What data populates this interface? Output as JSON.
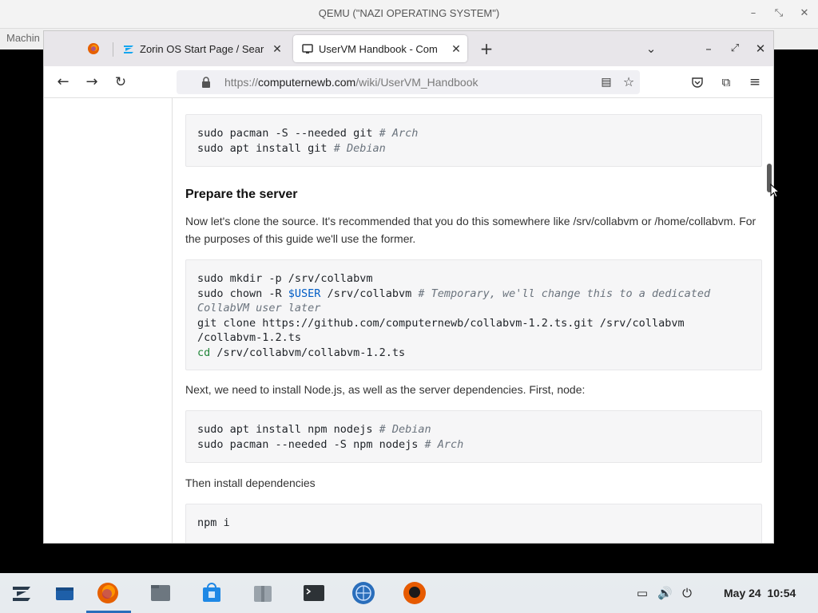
{
  "qemu": {
    "title": "QEMU (\"NAZI OPERATING SYSTEM\")",
    "menu_label": "Machin"
  },
  "browser": {
    "tabs": [
      {
        "label": "",
        "icon": "firefox-icon"
      },
      {
        "label": "Zorin OS Start Page / Sear",
        "icon": "zorin-icon"
      },
      {
        "label": "UserVM Handbook - Com",
        "icon": "uservm-icon"
      }
    ],
    "new_tab": "+",
    "url_scheme": "https://",
    "url_host": "computernewb.com",
    "url_path": "/wiki/UserVM_Handbook"
  },
  "page": {
    "code1": [
      {
        "cmd": "sudo pacman -S --needed git ",
        "comment": "# Arch"
      },
      {
        "cmd": "sudo apt install git ",
        "comment": "# Debian"
      }
    ],
    "heading_prepare": "Prepare the server",
    "para_clone": "Now let's clone the source. It's recommended that you do this somewhere like /srv/collabvm or /home/collabvm. For the purposes of this guide we'll use the former.",
    "code2": {
      "l1": "sudo mkdir -p /srv/collabvm",
      "l2_a": "sudo chown -R ",
      "l2_var": "$USER",
      "l2_b": " /srv/collabvm ",
      "l2_comment": "# Temporary, we'll change this to a dedicated",
      "l3_comment": "CollabVM user later",
      "l4": "git clone https://github.com/computernewb/collabvm-1.2.ts.git /srv/collabvm",
      "l5": "/collabvm-1.2.ts",
      "l6_kw": "cd",
      "l6_b": " /srv/collabvm/collabvm-1.2.ts"
    },
    "para_node": "Next, we need to install Node.js, as well as the server dependencies. First, node:",
    "code3": [
      {
        "cmd": "sudo apt install npm nodejs ",
        "comment": "# Debian"
      },
      {
        "cmd": "sudo pacman --needed -S npm nodejs ",
        "comment": "# Arch"
      }
    ],
    "para_deps": "Then install dependencies",
    "code4": "npm i"
  },
  "taskbar": {
    "date": "May 24",
    "time": "10:54"
  }
}
